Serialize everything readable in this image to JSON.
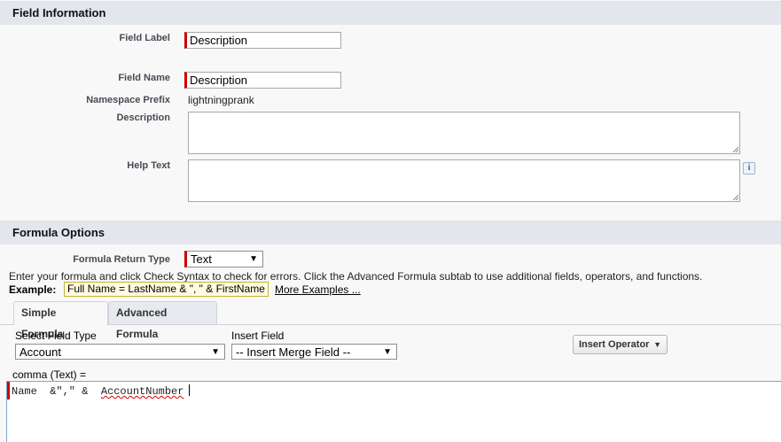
{
  "field_info": {
    "header": "Field Information",
    "field_label": {
      "label": "Field Label",
      "value": "Description"
    },
    "field_name": {
      "label": "Field Name",
      "value": "Description"
    },
    "namespace_prefix": {
      "label": "Namespace Prefix",
      "value": "lightningprank"
    },
    "description": {
      "label": "Description",
      "value": ""
    },
    "help_text": {
      "label": "Help Text",
      "value": "",
      "info_icon": "i"
    }
  },
  "formula_options": {
    "header": "Formula Options",
    "return_type": {
      "label": "Formula Return Type",
      "value": "Text"
    },
    "instructions": "Enter your formula and click Check Syntax to check for errors. Click the Advanced Formula subtab to use additional fields, operators, and functions.",
    "example_label": "Example:",
    "example_value": "Full Name = LastName & \", \" & FirstName",
    "more_examples": "More Examples ..."
  },
  "tabs": [
    {
      "label": "Simple Formula",
      "active": true
    },
    {
      "label": "Advanced Formula",
      "active": false
    }
  ],
  "formula_editor": {
    "select_field_type": {
      "label": "Select Field Type",
      "value": "Account"
    },
    "insert_field": {
      "label": "Insert Field",
      "value": "-- Insert Merge Field --"
    },
    "insert_operator": {
      "label": "Insert Operator"
    },
    "formula_title": "comma (Text) =",
    "code_part1": "Name  &\",\" &  ",
    "code_part2": "AccountNumber"
  },
  "colors": {
    "required": "#cc0000",
    "section_header": "#e3e6ec",
    "link": "#000000"
  }
}
